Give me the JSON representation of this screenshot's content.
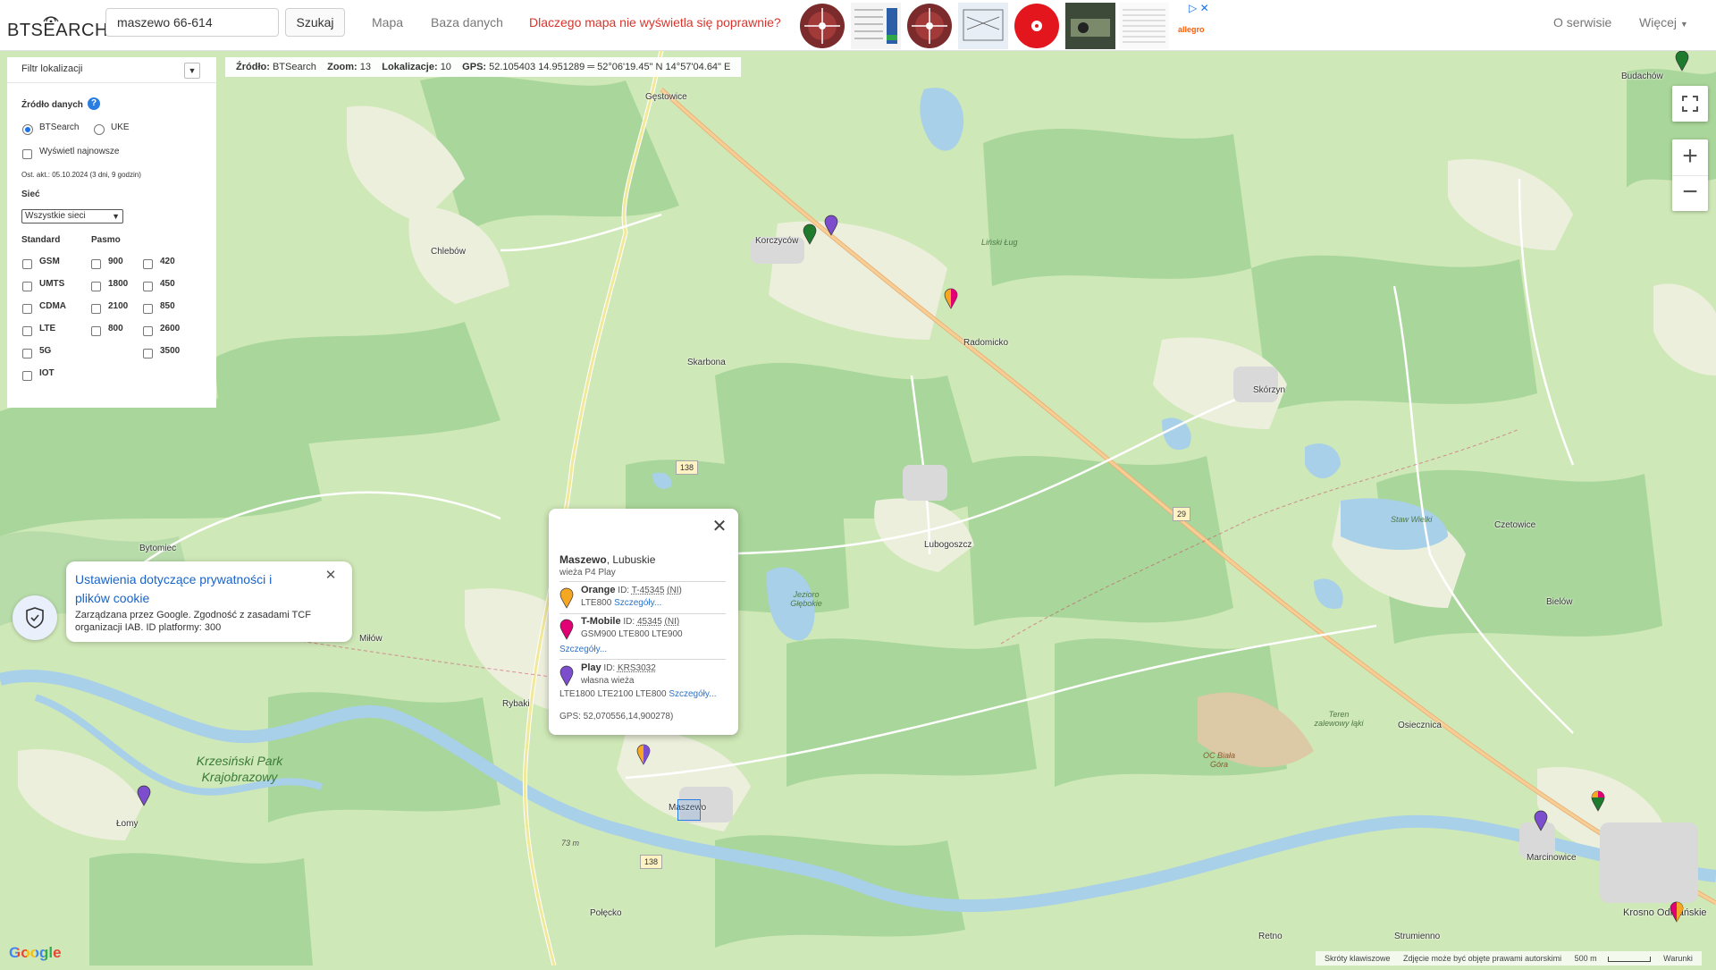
{
  "header": {
    "logo_text": "BTSEARCH",
    "search_value": "maszewo 66-614",
    "search_button": "Szukaj",
    "nav_map": "Mapa",
    "nav_database": "Baza danych",
    "nav_alert": "Dlaczego mapa nie wyświetla się poprawnie?",
    "nav_about": "O serwisie",
    "nav_more": "Więcej",
    "ad_brand": "allegro"
  },
  "info_strip": {
    "source_label": "Źródło:",
    "source_value": "BTSearch",
    "zoom_label": "Zoom:",
    "zoom_value": "13",
    "locations_label": "Lokalizacje:",
    "locations_value": "10",
    "gps_label": "GPS:",
    "gps_value": "52.105403 14.951289 ═ 52°06'19.45\" N 14°57'04.64\" E"
  },
  "filter": {
    "title": "Filtr lokalizacji",
    "source_heading": "Źródło danych",
    "source_btsearch": "BTSearch",
    "source_uke": "UKE",
    "show_newest": "Wyświetl najnowsze",
    "last_update": "Ost. akt.: 05.10.2024 (3 dni, 9 godzin)",
    "network_heading": "Sieć",
    "network_selected": "Wszystkie sieci",
    "standard_heading": "Standard",
    "band_heading": "Pasmo",
    "standards": [
      "GSM",
      "UMTS",
      "CDMA",
      "LTE",
      "5G",
      "IOT"
    ],
    "bands_col1": [
      "900",
      "1800",
      "2100",
      "800"
    ],
    "bands_col2": [
      "420",
      "450",
      "850",
      "2600",
      "3500"
    ]
  },
  "popup": {
    "place_name": "Maszewo",
    "place_region": ", Lubuskie",
    "tower_desc": "wieża P4 Play",
    "operators": [
      {
        "name": "Orange",
        "id_label": "ID:",
        "id": "T-45345",
        "flag": "(NI)",
        "tech": "LTE800",
        "link": "Szczegóły...",
        "color": "#f5a623"
      },
      {
        "name": "T-Mobile",
        "id_label": "ID:",
        "id": "45345",
        "flag": "(NI)",
        "tech": "GSM900 LTE800 LTE900",
        "link": "Szczegóły...",
        "color": "#e20074"
      },
      {
        "name": "Play",
        "id_label": "ID:",
        "id": "KRS3032",
        "owner": "własna wieża",
        "tech": "LTE1800 LTE2100 LTE800",
        "link": "Szczegóły...",
        "color": "#7c4dcc"
      }
    ],
    "gps": "GPS: 52,070556,14,900278)"
  },
  "cookie": {
    "title": "Ustawienia dotyczące prywatności i plików cookie",
    "text": "Zarządzana przez Google. Zgodność z zasadami TCF organizacji IAB. ID platformy: 300"
  },
  "map": {
    "places": {
      "gestowice": "Gęstowice",
      "chlebow": "Chlebów",
      "korczycow": "Korczyców",
      "skarbona": "Skarbona",
      "radomicko": "Radomicko",
      "skorzyn": "Skórzyn",
      "bytomiec": "Bytomiec",
      "lubogoszcz": "Lubogoszcz",
      "czetowice": "Czetowice",
      "bielow": "Bielów",
      "milow": "Miłów",
      "rybaki": "Rybaki",
      "osiecznica": "Osiecznica",
      "lomy": "Łomy",
      "maszewo": "Maszewo",
      "marcinowice": "Marcinowice",
      "krosno": "Krosno Odrzańskie",
      "polecko": "Połęcko",
      "retno": "Retno",
      "strumienno": "Strumienno",
      "budachow": "Budachów"
    },
    "small_labels": {
      "linski_lug": "Liński Ług",
      "staw_wielki": "Staw Wielki",
      "teren": "Teren zalewowy łąki",
      "oc_biala": "OC Biała Góra",
      "jezioro": "Jezioro Głębokie",
      "alt": "73 m"
    },
    "park": "Krzesiński Park Krajobrazowy",
    "roads": {
      "r138a": "138",
      "r29": "29",
      "r138b": "138"
    }
  },
  "footer": {
    "shortcuts": "Skróty klawiszowe",
    "copyright": "Zdjęcie może być objęte prawami autorskimi",
    "scale": "500 m",
    "terms": "Warunki"
  },
  "google_logo": "Google"
}
